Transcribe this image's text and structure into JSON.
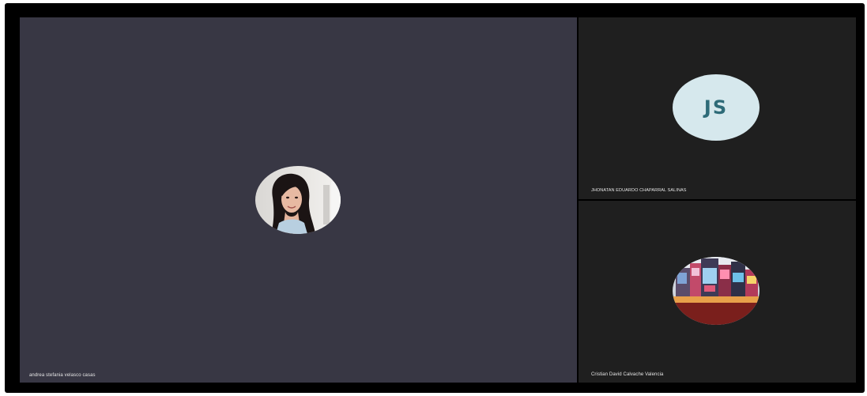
{
  "participants": [
    {
      "name": "andrea stefania velasco casas",
      "avatar": "profile-photo-woman-icon",
      "tile": "main"
    },
    {
      "name": "JHONATAN EDUARDO CHAPARRAL SALINAS",
      "initials": "JS",
      "tile": "side-top"
    },
    {
      "name": "Cristian David Calvache Valencia",
      "avatar": "profile-photo-city-icon",
      "tile": "side-bottom"
    }
  ],
  "colors": {
    "main_tile_bg": "#383744",
    "side_tile_bg": "#1f1f1f",
    "initials_bg": "#d6e8ed",
    "initials_text": "#2e6b78"
  }
}
